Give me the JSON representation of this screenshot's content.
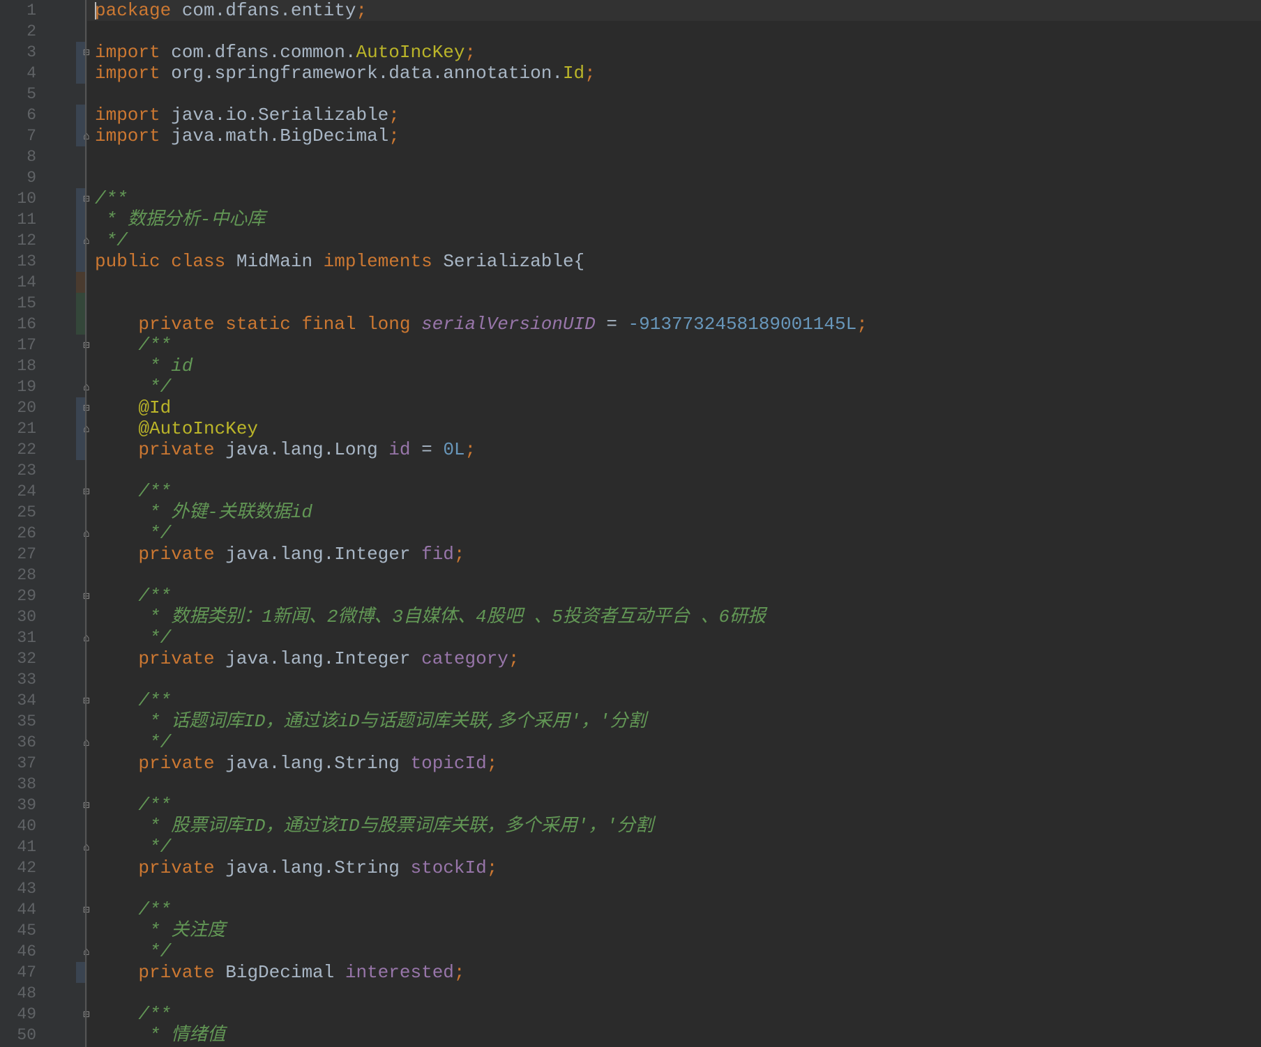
{
  "editor": {
    "colors": {
      "background": "#2b2b2b",
      "gutter": "#313335",
      "keyword": "#cc7832",
      "annotation": "#bbb529",
      "comment": "#629755",
      "field": "#9876aa",
      "number": "#6897bb",
      "text": "#a9b7c6"
    },
    "lines": [
      {
        "n": "1",
        "tokens": [
          {
            "t": "package",
            "c": "kw"
          },
          {
            "t": " com.dfans.entity",
            "c": "txt"
          },
          {
            "t": ";",
            "c": "kw"
          }
        ]
      },
      {
        "n": "2",
        "tokens": []
      },
      {
        "n": "3",
        "tokens": [
          {
            "t": "import",
            "c": "kw"
          },
          {
            "t": " com.dfans.common.",
            "c": "txt"
          },
          {
            "t": "AutoIncKey",
            "c": "ann"
          },
          {
            "t": ";",
            "c": "kw"
          }
        ]
      },
      {
        "n": "4",
        "tokens": [
          {
            "t": "import",
            "c": "kw"
          },
          {
            "t": " org.springframework.data.annotation.",
            "c": "txt"
          },
          {
            "t": "Id",
            "c": "ann"
          },
          {
            "t": ";",
            "c": "kw"
          }
        ]
      },
      {
        "n": "5",
        "tokens": []
      },
      {
        "n": "6",
        "tokens": [
          {
            "t": "import",
            "c": "kw"
          },
          {
            "t": " java.io.Serializable",
            "c": "txt"
          },
          {
            "t": ";",
            "c": "kw"
          }
        ]
      },
      {
        "n": "7",
        "tokens": [
          {
            "t": "import",
            "c": "kw"
          },
          {
            "t": " java.math.BigDecimal",
            "c": "txt"
          },
          {
            "t": ";",
            "c": "kw"
          }
        ]
      },
      {
        "n": "8",
        "tokens": []
      },
      {
        "n": "9",
        "tokens": []
      },
      {
        "n": "10",
        "tokens": [
          {
            "t": "/**",
            "c": "cmt"
          }
        ]
      },
      {
        "n": "11",
        "tokens": [
          {
            "t": " * 数据分析-中心库",
            "c": "cmt"
          }
        ]
      },
      {
        "n": "12",
        "tokens": [
          {
            "t": " */",
            "c": "cmt"
          }
        ]
      },
      {
        "n": "13",
        "tokens": [
          {
            "t": "public class ",
            "c": "kw"
          },
          {
            "t": "MidMain ",
            "c": "cls"
          },
          {
            "t": "implements ",
            "c": "kw"
          },
          {
            "t": "Serializable{",
            "c": "txt"
          }
        ]
      },
      {
        "n": "14",
        "tokens": []
      },
      {
        "n": "15",
        "tokens": []
      },
      {
        "n": "16",
        "tokens": [
          {
            "t": "    private static final long ",
            "c": "kw"
          },
          {
            "t": "serialVersionUID",
            "c": "sfld"
          },
          {
            "t": " = ",
            "c": "txt"
          },
          {
            "t": "-9137732458189001145L",
            "c": "num"
          },
          {
            "t": ";",
            "c": "kw"
          }
        ]
      },
      {
        "n": "17",
        "tokens": [
          {
            "t": "    /**",
            "c": "cmt"
          }
        ]
      },
      {
        "n": "18",
        "tokens": [
          {
            "t": "     * id",
            "c": "cmt"
          }
        ]
      },
      {
        "n": "19",
        "tokens": [
          {
            "t": "     */",
            "c": "cmt"
          }
        ]
      },
      {
        "n": "20",
        "tokens": [
          {
            "t": "    @Id",
            "c": "ann"
          }
        ]
      },
      {
        "n": "21",
        "tokens": [
          {
            "t": "    @AutoIncKey",
            "c": "ann"
          }
        ]
      },
      {
        "n": "22",
        "tokens": [
          {
            "t": "    private ",
            "c": "kw"
          },
          {
            "t": "java.lang.Long ",
            "c": "txt"
          },
          {
            "t": "id",
            "c": "fld"
          },
          {
            "t": " = ",
            "c": "txt"
          },
          {
            "t": "0L",
            "c": "num"
          },
          {
            "t": ";",
            "c": "kw"
          }
        ]
      },
      {
        "n": "23",
        "tokens": []
      },
      {
        "n": "24",
        "tokens": [
          {
            "t": "    /**",
            "c": "cmt"
          }
        ]
      },
      {
        "n": "25",
        "tokens": [
          {
            "t": "     * 外键-关联数据id",
            "c": "cmt"
          }
        ]
      },
      {
        "n": "26",
        "tokens": [
          {
            "t": "     */",
            "c": "cmt"
          }
        ]
      },
      {
        "n": "27",
        "tokens": [
          {
            "t": "    private ",
            "c": "kw"
          },
          {
            "t": "java.lang.Integer ",
            "c": "txt"
          },
          {
            "t": "fid",
            "c": "fld"
          },
          {
            "t": ";",
            "c": "kw"
          }
        ]
      },
      {
        "n": "28",
        "tokens": []
      },
      {
        "n": "29",
        "tokens": [
          {
            "t": "    /**",
            "c": "cmt"
          }
        ]
      },
      {
        "n": "30",
        "tokens": [
          {
            "t": "     * 数据类别：1新闻、2微博、3自媒体、4股吧 、5投资者互动平台 、6研报",
            "c": "cmt"
          }
        ]
      },
      {
        "n": "31",
        "tokens": [
          {
            "t": "     */",
            "c": "cmt"
          }
        ]
      },
      {
        "n": "32",
        "tokens": [
          {
            "t": "    private ",
            "c": "kw"
          },
          {
            "t": "java.lang.Integer ",
            "c": "txt"
          },
          {
            "t": "category",
            "c": "fld"
          },
          {
            "t": ";",
            "c": "kw"
          }
        ]
      },
      {
        "n": "33",
        "tokens": []
      },
      {
        "n": "34",
        "tokens": [
          {
            "t": "    /**",
            "c": "cmt"
          }
        ]
      },
      {
        "n": "35",
        "tokens": [
          {
            "t": "     * 话题词库ID，通过该iD与话题词库关联,多个采用'，'分割",
            "c": "cmt"
          }
        ]
      },
      {
        "n": "36",
        "tokens": [
          {
            "t": "     */",
            "c": "cmt"
          }
        ]
      },
      {
        "n": "37",
        "tokens": [
          {
            "t": "    private ",
            "c": "kw"
          },
          {
            "t": "java.lang.String ",
            "c": "txt"
          },
          {
            "t": "topicId",
            "c": "fld"
          },
          {
            "t": ";",
            "c": "kw"
          }
        ]
      },
      {
        "n": "38",
        "tokens": []
      },
      {
        "n": "39",
        "tokens": [
          {
            "t": "    /**",
            "c": "cmt"
          }
        ]
      },
      {
        "n": "40",
        "tokens": [
          {
            "t": "     * 股票词库ID，通过该ID与股票词库关联，多个采用'，'分割",
            "c": "cmt"
          }
        ]
      },
      {
        "n": "41",
        "tokens": [
          {
            "t": "     */",
            "c": "cmt"
          }
        ]
      },
      {
        "n": "42",
        "tokens": [
          {
            "t": "    private ",
            "c": "kw"
          },
          {
            "t": "java.lang.String ",
            "c": "txt"
          },
          {
            "t": "stockId",
            "c": "fld"
          },
          {
            "t": ";",
            "c": "kw"
          }
        ]
      },
      {
        "n": "43",
        "tokens": []
      },
      {
        "n": "44",
        "tokens": [
          {
            "t": "    /**",
            "c": "cmt"
          }
        ]
      },
      {
        "n": "45",
        "tokens": [
          {
            "t": "     * 关注度",
            "c": "cmt"
          }
        ]
      },
      {
        "n": "46",
        "tokens": [
          {
            "t": "     */",
            "c": "cmt"
          }
        ]
      },
      {
        "n": "47",
        "tokens": [
          {
            "t": "    private ",
            "c": "kw"
          },
          {
            "t": "BigDecimal ",
            "c": "txt"
          },
          {
            "t": "interested",
            "c": "fld"
          },
          {
            "t": ";",
            "c": "kw"
          }
        ]
      },
      {
        "n": "48",
        "tokens": []
      },
      {
        "n": "49",
        "tokens": [
          {
            "t": "    /**",
            "c": "cmt"
          }
        ]
      },
      {
        "n": "50",
        "tokens": [
          {
            "t": "     * 情绪值",
            "c": "cmt"
          }
        ]
      }
    ]
  }
}
